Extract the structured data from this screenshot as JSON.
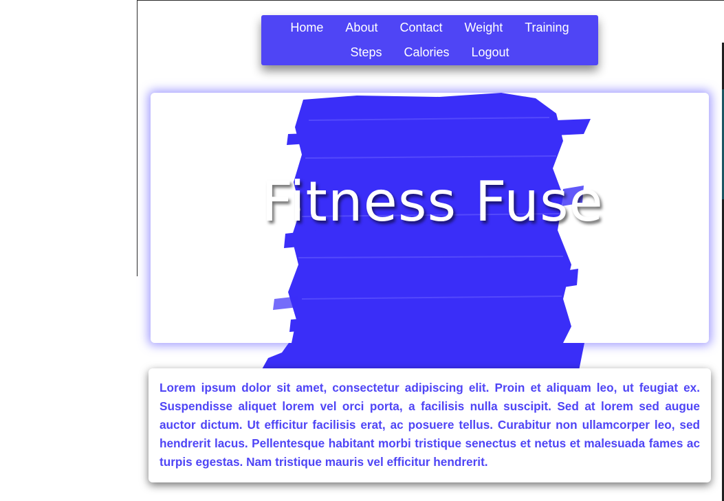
{
  "nav": {
    "row1": [
      "Home",
      "About",
      "Contact",
      "Weight",
      "Training"
    ],
    "row2": [
      "Steps",
      "Calories",
      "Logout"
    ]
  },
  "hero": {
    "title": "Fitness Fuse",
    "brush_color": "#3a2ef8"
  },
  "intro": {
    "text": "Lorem ipsum dolor sit amet, consectetur adipiscing elit. Proin et aliquam leo, ut feugiat ex. Suspendisse aliquet lorem vel orci porta, a facilisis nulla suscipit. Sed at lorem sed augue auctor dictum. Ut efficitur facilisis erat, ac posuere tellus. Curabitur non ullamcorper leo, sed hendrerit lacus. Pellentesque habitant morbi tristique senectus et netus et malesuada fames ac turpis egestas. Nam tristique mauris vel efficitur hendrerit."
  },
  "colors": {
    "accent": "#4f45f5",
    "text": "#4f45f5",
    "background": "#ffffff"
  }
}
